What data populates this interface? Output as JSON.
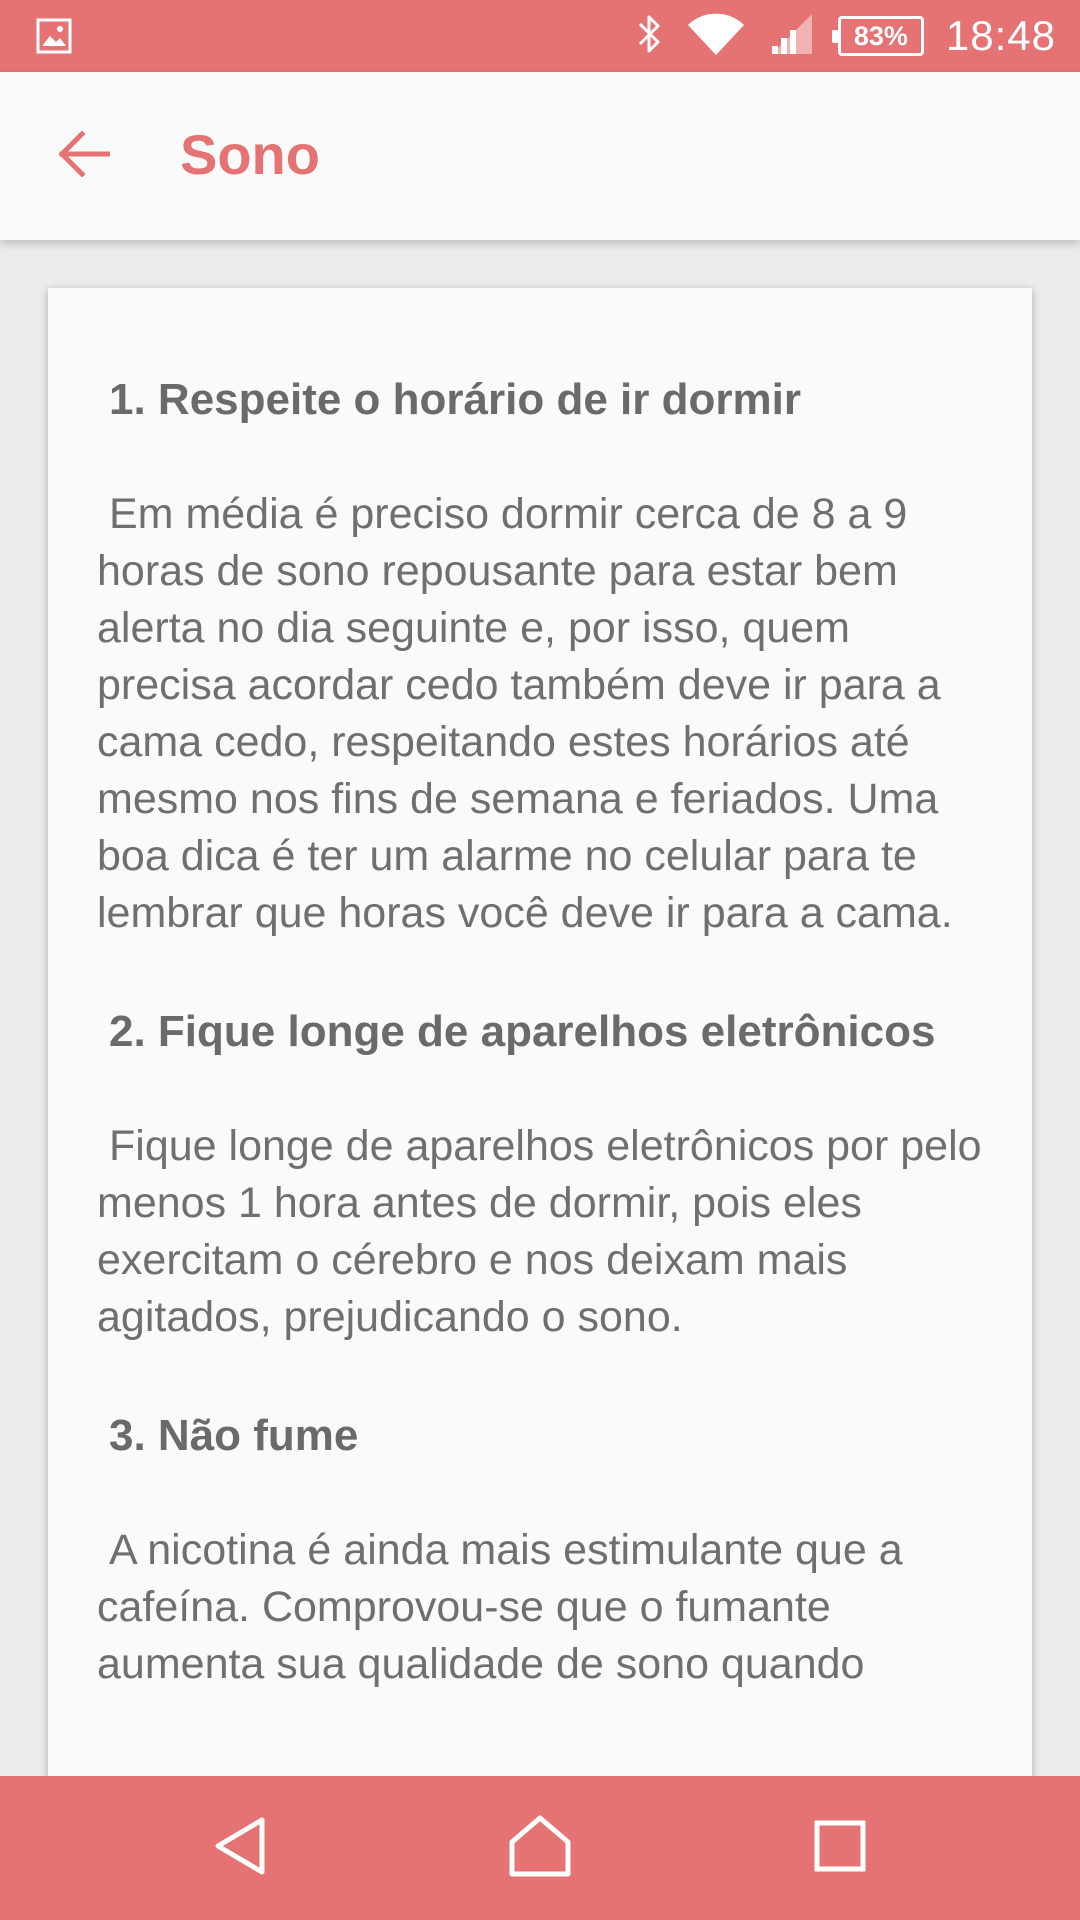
{
  "status_bar": {
    "battery_percent": "83%",
    "time": "18:48",
    "icons": [
      "image-notification-icon",
      "bluetooth-icon",
      "wifi-icon",
      "signal-icon",
      "battery-icon"
    ]
  },
  "app_bar": {
    "title": "Sono",
    "back_icon": "arrow-back-icon"
  },
  "content": {
    "sections": [
      {
        "title": "1. Respeite o horário de ir dormir",
        "body": "Em média é preciso dormir cerca de 8 a 9 horas de sono repousante para estar bem alerta no dia seguinte e, por isso, quem precisa acordar cedo também deve ir para a cama cedo, respeitando estes horários até mesmo nos fins de semana e feriados. Uma boa dica é ter um alarme no celular para te lembrar que horas você deve ir para a cama."
      },
      {
        "title": "2. Fique longe de aparelhos eletrônicos",
        "body": "Fique longe de aparelhos eletrônicos por pelo menos 1 hora antes de dormir, pois eles exercitam o cérebro e nos deixam mais agitados, prejudicando o sono."
      },
      {
        "title": "3. Não fume",
        "body": "A nicotina é ainda mais estimulante que a cafeína. Comprovou-se que o fumante aumenta sua qualidade de sono quando"
      }
    ]
  },
  "nav_bar": {
    "icons": [
      "back-triangle-icon",
      "home-icon",
      "recents-square-icon"
    ]
  },
  "colors": {
    "accent": "#e57373",
    "text": "#6f6f6f",
    "surface": "#fafafa",
    "background": "#ececec"
  }
}
